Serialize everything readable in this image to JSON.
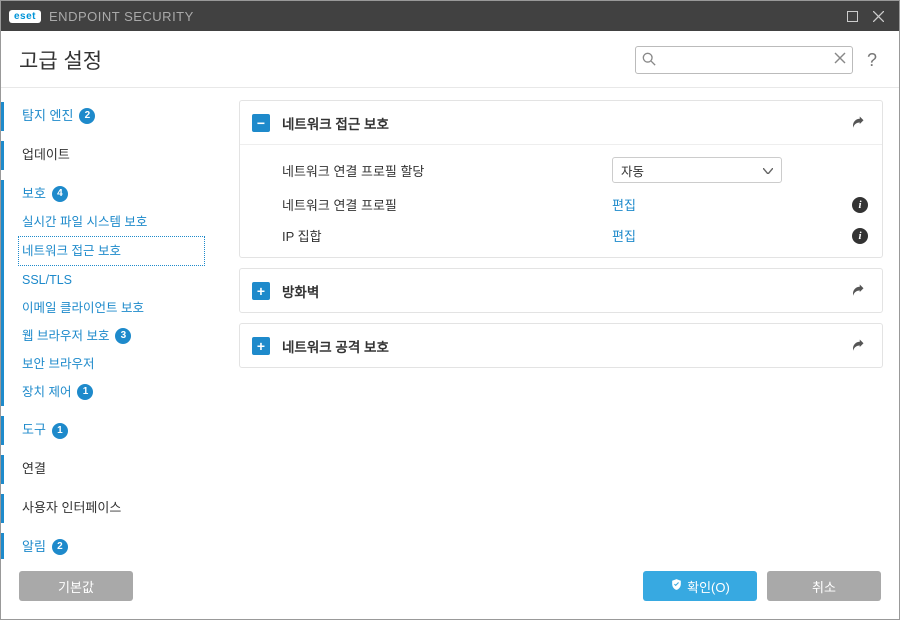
{
  "app": {
    "brand_badge": "eset",
    "brand_name": "ENDPOINT SECURITY"
  },
  "header": {
    "title": "고급 설정",
    "search_placeholder": "",
    "help_label": "?"
  },
  "sidebar": {
    "items": [
      {
        "label": "탐지 엔진",
        "badge": "2",
        "link": true,
        "accent": true
      },
      {
        "label": "업데이트",
        "accent": true
      },
      {
        "label": "보호",
        "badge": "4",
        "link": true,
        "accent": true,
        "children": [
          {
            "label": "실시간 파일 시스템 보호"
          },
          {
            "label": "네트워크 접근 보호",
            "selected": true
          },
          {
            "label": "SSL/TLS"
          },
          {
            "label": "이메일 클라이언트 보호"
          },
          {
            "label": "웹 브라우저 보호",
            "badge": "3"
          },
          {
            "label": "보안 브라우저"
          },
          {
            "label": "장치 제어",
            "badge": "1"
          }
        ]
      },
      {
        "label": "도구",
        "badge": "1",
        "link": true,
        "accent": true
      },
      {
        "label": "연결",
        "accent": true
      },
      {
        "label": "사용자 인터페이스",
        "accent": true
      },
      {
        "label": "알림",
        "badge": "2",
        "link": true,
        "accent": true
      }
    ]
  },
  "panels": [
    {
      "title": "네트워크 접근 보호",
      "expanded": true,
      "rows": [
        {
          "label": "네트워크 연결 프로필 할당",
          "type": "select",
          "value": "자동"
        },
        {
          "label": "네트워크 연결 프로필",
          "type": "link",
          "value": "편집",
          "info": true
        },
        {
          "label": "IP 집합",
          "type": "link",
          "value": "편집",
          "info": true
        }
      ]
    },
    {
      "title": "방화벽",
      "expanded": false
    },
    {
      "title": "네트워크 공격 보호",
      "expanded": false
    }
  ],
  "footer": {
    "default_btn": "기본값",
    "ok_btn": "확인(O)",
    "cancel_btn": "취소"
  }
}
